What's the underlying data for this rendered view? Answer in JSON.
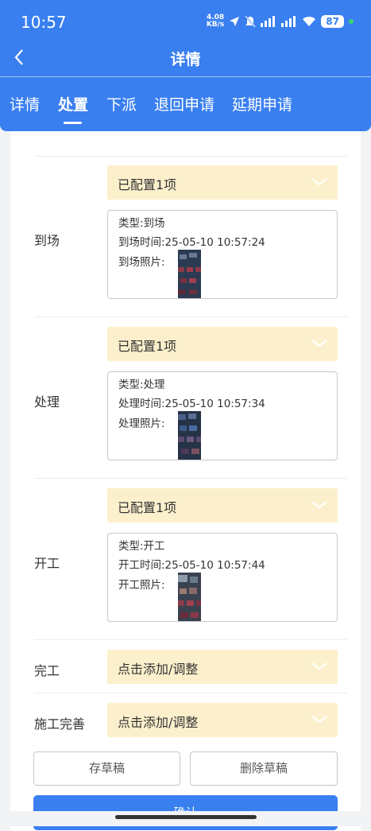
{
  "status_bar": {
    "time": "10:57",
    "net_speed_top": "4.08",
    "net_speed_bottom": "KB/s",
    "battery": "87"
  },
  "nav": {
    "title": "详情"
  },
  "tabs": [
    {
      "label": "详情"
    },
    {
      "label": "处置"
    },
    {
      "label": "下派"
    },
    {
      "label": "退回申请"
    },
    {
      "label": "延期申请"
    }
  ],
  "active_tab": "处置",
  "sections": [
    {
      "label": "到场",
      "select_value": "已配置1项",
      "type_line": "类型:到场",
      "time_line": "到场时间:25-05-10 10:57:24",
      "photo_label": "到场照片:"
    },
    {
      "label": "处理",
      "select_value": "已配置1项",
      "type_line": "类型:处理",
      "time_line": "处理时间:25-05-10 10:57:34",
      "photo_label": "处理照片:"
    },
    {
      "label": "开工",
      "select_value": "已配置1项",
      "type_line": "类型:开工",
      "time_line": "开工时间:25-05-10 10:57:44",
      "photo_label": "开工照片:"
    }
  ],
  "complete": {
    "label": "完工",
    "select_value": "点击添加/调整"
  },
  "improve": {
    "label": "施工完善",
    "select_value": "点击添加/调整"
  },
  "buttons": {
    "save_draft": "存草稿",
    "delete_draft": "删除草稿",
    "confirm": "确认"
  },
  "colors": {
    "primary": "#3a7ff0",
    "select_bg": "#fcf0cc"
  }
}
